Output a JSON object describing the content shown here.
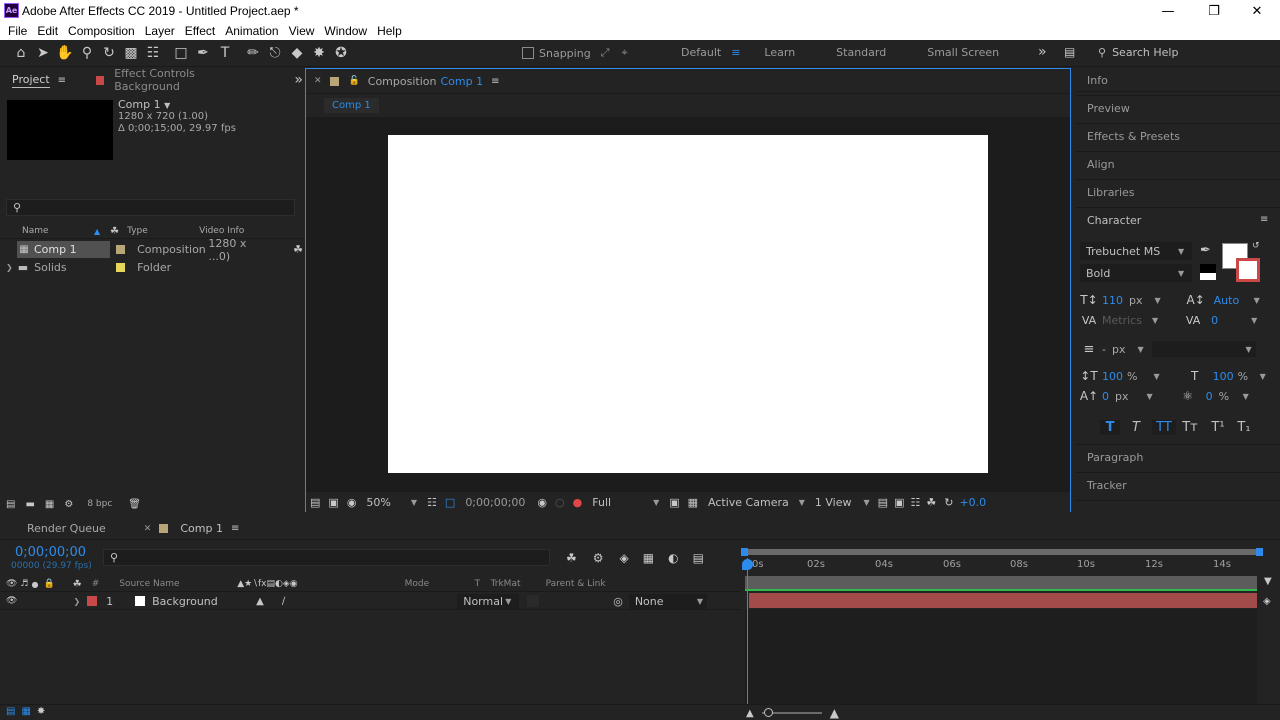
{
  "app": {
    "icon_text": "Ae",
    "title": "Adobe After Effects CC 2019 - Untitled Project.aep *"
  },
  "menu": [
    "File",
    "Edit",
    "Composition",
    "Layer",
    "Effect",
    "Animation",
    "View",
    "Window",
    "Help"
  ],
  "toolbar": {
    "snapping_label": "Snapping",
    "workspaces": [
      "Default",
      "Learn",
      "Standard",
      "Small Screen"
    ],
    "active_workspace": "Default",
    "search_placeholder": "Search Help"
  },
  "project": {
    "tab": "Project",
    "effect_controls_tab": "Effect Controls Background",
    "selected_name": "Comp 1",
    "selected_info1": "1280 x 720 (1.00)",
    "selected_info2": "Δ 0;00;15;00, 29.97 fps",
    "columns": {
      "name": "Name",
      "type": "Type",
      "video_info": "Video Info"
    },
    "items": [
      {
        "name": "Comp 1",
        "type": "Composition",
        "video_info": "1280 x ...0)",
        "label_color": "#b9a678"
      },
      {
        "name": "Solids",
        "type": "Folder",
        "video_info": "",
        "label_color": "#e6d65c"
      }
    ],
    "bpc": "8 bpc"
  },
  "composition": {
    "tab_prefix": "Composition",
    "tab_name": "Comp 1",
    "breadcrumb": "Comp 1",
    "zoom": "50%",
    "timecode": "0;00;00;00",
    "resolution": "Full",
    "camera": "Active Camera",
    "views": "1 View",
    "exposure": "+0.0"
  },
  "right_panel": {
    "items_top": [
      "Info",
      "Preview",
      "Effects & Presets",
      "Align",
      "Libraries"
    ],
    "character": {
      "title": "Character",
      "font": "Trebuchet MS",
      "style": "Bold",
      "size": "110",
      "size_unit": "px",
      "leading": "Auto",
      "kerning": "Metrics",
      "tracking": "0",
      "stroke_width": "-",
      "stroke_unit": "px",
      "vscale": "100",
      "hscale": "100",
      "scale_unit": "%",
      "baseline": "0",
      "baseline_unit": "px",
      "tsume": "0",
      "tsume_unit": "%",
      "style_buttons": [
        "T",
        "T",
        "TT",
        "Tт",
        "T¹",
        "T₁"
      ]
    },
    "items_bottom": [
      "Paragraph",
      "Tracker"
    ]
  },
  "timeline": {
    "render_queue_tab": "Render Queue",
    "comp_tab": "Comp 1",
    "timecode": "0;00;00;00",
    "frame_info": "00000 (29.97 fps)",
    "columns": {
      "number": "#",
      "source_name": "Source Name",
      "mode": "Mode",
      "t": "T",
      "trkmat": "TrkMat",
      "parent": "Parent & Link"
    },
    "ruler": [
      "0s",
      "02s",
      "04s",
      "06s",
      "08s",
      "10s",
      "12s",
      "14s"
    ],
    "layers": [
      {
        "number": "1",
        "name": "Background",
        "mode": "Normal",
        "parent": "None",
        "label_color": "#c94848"
      }
    ]
  }
}
